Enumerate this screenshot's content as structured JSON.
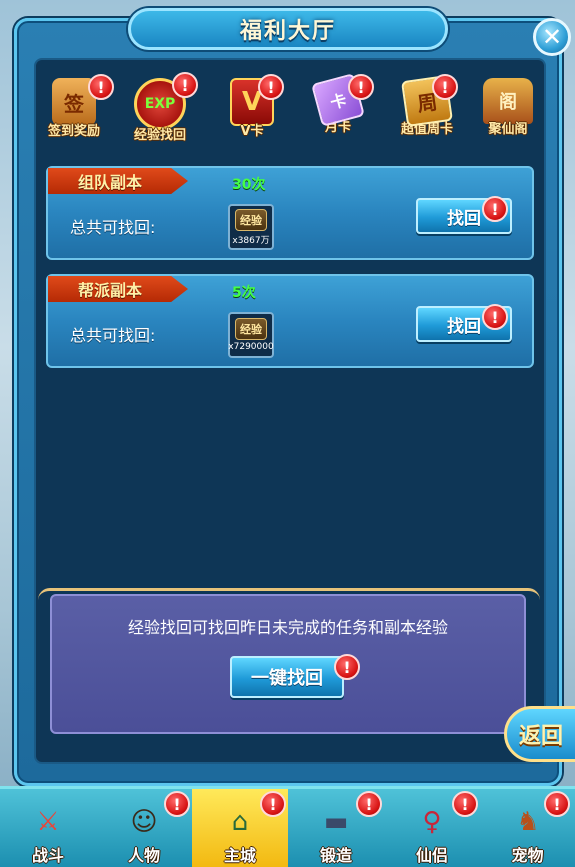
{
  "window": {
    "title": "福利大厅",
    "close_icon": "close-icon"
  },
  "tabs": [
    {
      "label": "签到奖励",
      "icon": "sign-in-icon",
      "badge": "!"
    },
    {
      "label": "经验找回",
      "icon": "exp-bag-icon",
      "icon_text": "EXP",
      "badge": "!",
      "selected": true
    },
    {
      "label": "V卡",
      "icon": "vip-card-icon",
      "icon_text": "V",
      "badge": "!"
    },
    {
      "label": "月卡",
      "icon": "month-card-icon",
      "badge": "!"
    },
    {
      "label": "超值周卡",
      "icon": "week-card-icon",
      "icon_text": "周",
      "badge": "!"
    },
    {
      "label": "聚仙阁",
      "icon": "pavilion-icon"
    }
  ],
  "recovery_items": [
    {
      "title": "组队副本",
      "count": "30次",
      "label": "总共可找回:",
      "reward_name": "经验",
      "reward_qty": "x3867万",
      "button": "找回",
      "badge": "!"
    },
    {
      "title": "帮派副本",
      "count": "5次",
      "label": "总共可找回:",
      "reward_name": "经验",
      "reward_qty": "x7290000",
      "button": "找回",
      "badge": "!"
    }
  ],
  "info": {
    "description": "经验找回可找回昨日未完成的任务和副本经验",
    "onekey_button": "一键找回",
    "badge": "!"
  },
  "return_button": "返回",
  "bottom_nav": [
    {
      "label": "战斗",
      "icon": "sword-icon"
    },
    {
      "label": "人物",
      "icon": "character-icon",
      "badge": "!"
    },
    {
      "label": "主城",
      "icon": "city-icon",
      "badge": "!",
      "active": true
    },
    {
      "label": "锻造",
      "icon": "anvil-icon",
      "badge": "!"
    },
    {
      "label": "仙侣",
      "icon": "companion-icon",
      "badge": "!"
    },
    {
      "label": "宠物",
      "icon": "pet-icon",
      "badge": "!"
    }
  ],
  "colors": {
    "accent_blue": "#2a85bf",
    "ribbon_red": "#b52a05",
    "count_green": "#44ff44",
    "badge_red": "#d81414",
    "nav_active": "#f2b70e"
  }
}
